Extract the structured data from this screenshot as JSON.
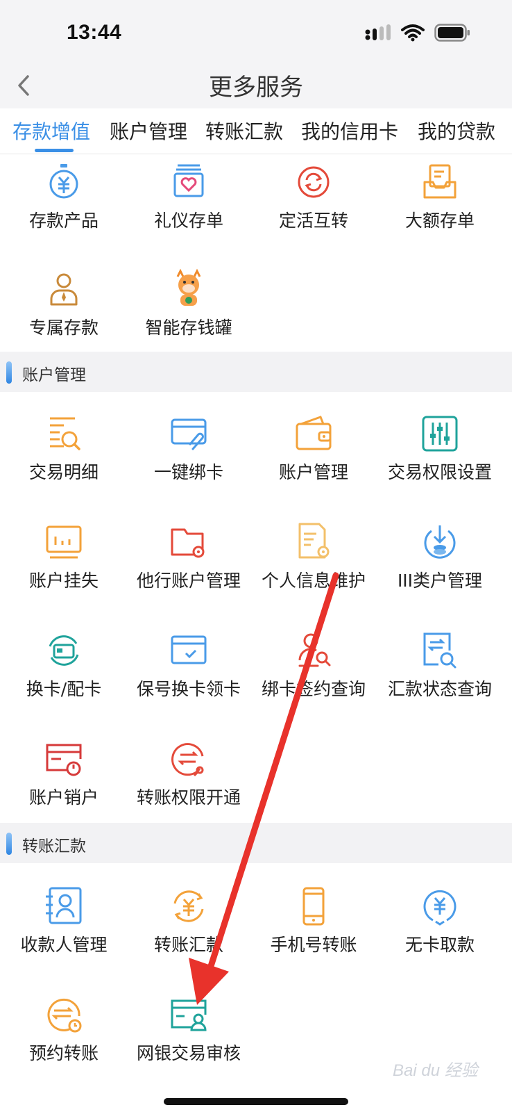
{
  "status": {
    "time": "13:44"
  },
  "nav": {
    "title": "更多服务"
  },
  "tabs": [
    {
      "label": "存款增值",
      "active": true
    },
    {
      "label": "账户管理"
    },
    {
      "label": "转账汇款"
    },
    {
      "label": "我的信用卡"
    },
    {
      "label": "我的贷款"
    }
  ],
  "deposit": {
    "items": [
      {
        "label": "存款产品",
        "icon": "yuan-stopwatch-icon"
      },
      {
        "label": "礼仪存单",
        "icon": "heart-box-icon"
      },
      {
        "label": "定活互转",
        "icon": "exchange-circle-icon"
      },
      {
        "label": "大额存单",
        "icon": "document-tray-icon"
      },
      {
        "label": "专属存款",
        "icon": "person-icon"
      },
      {
        "label": "智能存钱罐",
        "icon": "mascot-icon"
      }
    ]
  },
  "account": {
    "title": "账户管理",
    "items": [
      {
        "label": "交易明细",
        "icon": "list-search-icon"
      },
      {
        "label": "一键绑卡",
        "icon": "card-clip-icon"
      },
      {
        "label": "账户管理",
        "icon": "wallet-icon"
      },
      {
        "label": "交易权限设置",
        "icon": "sliders-icon"
      },
      {
        "label": "账户挂失",
        "icon": "monitor-icon"
      },
      {
        "label": "他行账户管理",
        "icon": "folder-gear-icon"
      },
      {
        "label": "个人信息维护",
        "icon": "doc-gear-icon"
      },
      {
        "label": "III类户管理",
        "icon": "download-coin-icon"
      },
      {
        "label": "换卡/配卡",
        "icon": "card-refresh-icon"
      },
      {
        "label": "保号换卡领卡",
        "icon": "card-check-icon"
      },
      {
        "label": "绑卡签约查询",
        "icon": "person-search-icon"
      },
      {
        "label": "汇款状态查询",
        "icon": "transfer-search-icon"
      },
      {
        "label": "账户销户",
        "icon": "card-power-icon"
      },
      {
        "label": "转账权限开通",
        "icon": "transfer-key-icon"
      }
    ]
  },
  "transfer": {
    "title": "转账汇款",
    "items": [
      {
        "label": "收款人管理",
        "icon": "contact-card-icon"
      },
      {
        "label": "转账汇款",
        "icon": "yuan-refresh-icon"
      },
      {
        "label": "手机号转账",
        "icon": "phone-icon"
      },
      {
        "label": "无卡取款",
        "icon": "yuan-circle-icon"
      },
      {
        "label": "预约转账",
        "icon": "transfer-clock-icon"
      },
      {
        "label": "网银交易审核",
        "icon": "card-person-icon"
      }
    ]
  },
  "colors": {
    "accent": "#3a8fe6",
    "orange": "#f3a23a",
    "red": "#e44a3a",
    "teal": "#1fa39b",
    "blue": "#4a9be8",
    "annotation": "#e8322b"
  },
  "watermark": "Bai du 经验"
}
